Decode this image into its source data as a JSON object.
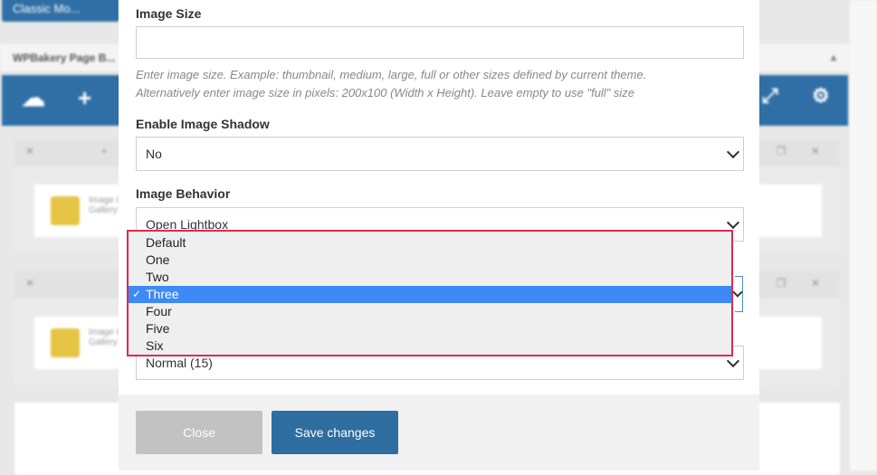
{
  "background": {
    "top_button_label": "Classic Mo...",
    "panel_title": "WPBakery Page B...",
    "card_title": "Image G...",
    "card_subtitle": "Gallery: 5"
  },
  "modal": {
    "image_size": {
      "label": "Image Size",
      "value": "",
      "help_line1": "Enter image size. Example: thumbnail, medium, large, full or other sizes defined by current theme.",
      "help_line2": "Alternatively enter image size in pixels: 200x100 (Width x Height). Leave empty to use \"full\" size"
    },
    "shadow": {
      "label": "Enable Image Shadow",
      "value": "No"
    },
    "behavior": {
      "label": "Image Behavior",
      "value": "Open Lightbox"
    },
    "columns_dropdown": {
      "options": [
        "Default",
        "One",
        "Two",
        "Three",
        "Four",
        "Five",
        "Six"
      ],
      "selected_index": 3,
      "check_glyph": "✓"
    },
    "spacing": {
      "value": "Normal (15)"
    },
    "footer": {
      "close_label": "Close",
      "save_label": "Save changes"
    }
  },
  "colors": {
    "primary": "#2e6da0",
    "selected_option": "#3d8af7",
    "dropdown_border": "#e0294f",
    "close_button": "#c2c2c2"
  }
}
